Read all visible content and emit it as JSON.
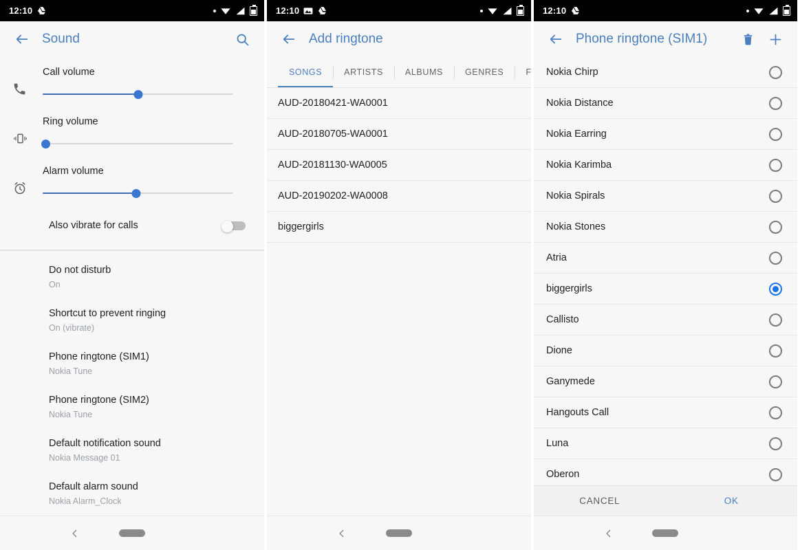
{
  "status_bar": {
    "time": "12:10",
    "icons_left": [
      "drive-icon"
    ],
    "icons_right": [
      "dot-icon",
      "wifi-icon",
      "signal-icon",
      "battery-icon"
    ]
  },
  "status_bar_2": {
    "time": "12:10",
    "icons_left": [
      "photo-icon",
      "drive-icon"
    ]
  },
  "colors": {
    "accent": "#4a7fbe",
    "radio_selected": "#1a73e8",
    "slider": "#3a76d2",
    "status_bg": "#000000",
    "page_bg": "#f7f7f7"
  },
  "panel1": {
    "title": "Sound",
    "back_icon": "arrow-left-icon",
    "search_icon": "search-icon",
    "volumes": [
      {
        "icon": "phone-icon",
        "label": "Call volume",
        "value": 50
      },
      {
        "icon": "vibrate-icon",
        "label": "Ring volume",
        "value": 0
      },
      {
        "icon": "alarm-clock-icon",
        "label": "Alarm volume",
        "value": 49
      }
    ],
    "vibrate_row": {
      "label": "Also vibrate for calls",
      "enabled": false
    },
    "settings": [
      {
        "title": "Do not disturb",
        "subtitle": "On"
      },
      {
        "title": "Shortcut to prevent ringing",
        "subtitle": "On (vibrate)"
      },
      {
        "title": "Phone ringtone (SIM1)",
        "subtitle": "Nokia Tune"
      },
      {
        "title": "Phone ringtone (SIM2)",
        "subtitle": "Nokia Tune"
      },
      {
        "title": "Default notification sound",
        "subtitle": "Nokia Message 01"
      },
      {
        "title": "Default alarm sound",
        "subtitle": "Nokia Alarm_Clock"
      }
    ]
  },
  "panel2": {
    "title": "Add ringtone",
    "back_icon": "arrow-left-icon",
    "tabs": [
      {
        "label": "SONGS",
        "active": true
      },
      {
        "label": "ARTISTS",
        "active": false
      },
      {
        "label": "ALBUMS",
        "active": false
      },
      {
        "label": "GENRES",
        "active": false
      },
      {
        "label": "FOLDERS",
        "active": false
      }
    ],
    "songs": [
      "AUD-20180421-WA0001",
      "AUD-20180705-WA0001",
      "AUD-20181130-WA0005",
      "AUD-20190202-WA0008",
      "biggergirls"
    ]
  },
  "panel3": {
    "title": "Phone ringtone (SIM1)",
    "back_icon": "arrow-left-icon",
    "delete_icon": "trash-icon",
    "add_icon": "plus-icon",
    "ringtones": [
      {
        "name": "Nokia Chirp",
        "selected": false
      },
      {
        "name": "Nokia Distance",
        "selected": false
      },
      {
        "name": "Nokia Earring",
        "selected": false
      },
      {
        "name": "Nokia Karimba",
        "selected": false
      },
      {
        "name": "Nokia Spirals",
        "selected": false
      },
      {
        "name": "Nokia Stones",
        "selected": false
      },
      {
        "name": "Atria",
        "selected": false
      },
      {
        "name": "biggergirls",
        "selected": true
      },
      {
        "name": "Callisto",
        "selected": false
      },
      {
        "name": "Dione",
        "selected": false
      },
      {
        "name": "Ganymede",
        "selected": false
      },
      {
        "name": "Hangouts Call",
        "selected": false
      },
      {
        "name": "Luna",
        "selected": false
      },
      {
        "name": "Oberon",
        "selected": false
      }
    ],
    "cancel_label": "CANCEL",
    "ok_label": "OK"
  },
  "navbar": {
    "back_icon": "chevron-left-icon",
    "home_icon": "home-pill-icon"
  }
}
